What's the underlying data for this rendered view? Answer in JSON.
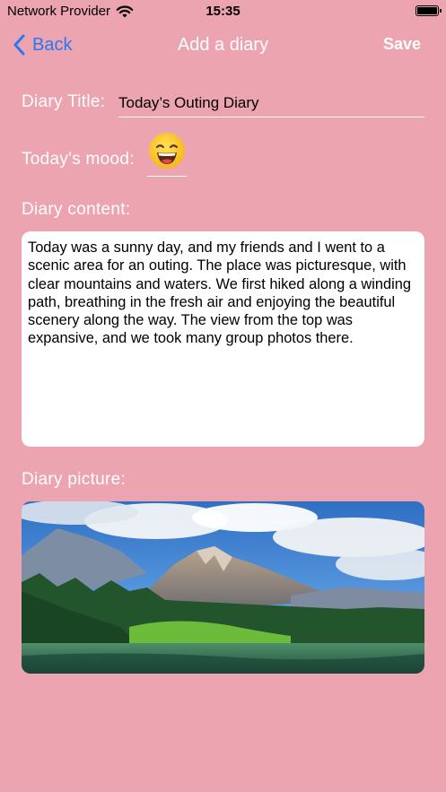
{
  "status_bar": {
    "carrier": "Network Provider",
    "time": "15:35",
    "wifi_icon": "wifi-icon",
    "battery_icon": "battery-full-icon"
  },
  "nav": {
    "back_label": "Back",
    "title": "Add a diary",
    "save_label": "Save",
    "accent_color": "#2a78f0"
  },
  "form": {
    "title_label": "Diary Title:",
    "title_value": "Today’s Outing Diary",
    "mood_label": "Today's mood:",
    "mood_icon": "grinning-face-icon",
    "content_label": "Diary content:",
    "content_value": "Today was a sunny day, and my friends and I went to a scenic area for an outing. The place was picturesque, with clear mountains and waters. We first hiked along a winding path, breathing in the fresh air and enjoying the beautiful scenery along the way. The view from the top was expansive, and we took many group photos there.",
    "picture_label": "Diary picture:",
    "picture_icon": "mountain-lake-landscape-photo"
  },
  "theme": {
    "background": "#eca4b1"
  }
}
